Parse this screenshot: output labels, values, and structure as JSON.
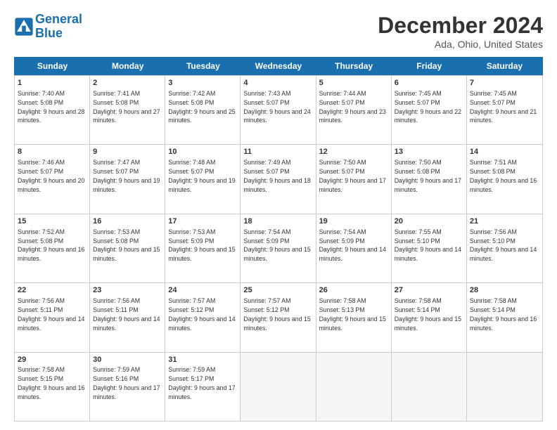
{
  "header": {
    "logo_line1": "General",
    "logo_line2": "Blue",
    "month": "December 2024",
    "location": "Ada, Ohio, United States"
  },
  "weekdays": [
    "Sunday",
    "Monday",
    "Tuesday",
    "Wednesday",
    "Thursday",
    "Friday",
    "Saturday"
  ],
  "weeks": [
    [
      {
        "day": "1",
        "sunrise": "Sunrise: 7:40 AM",
        "sunset": "Sunset: 5:08 PM",
        "daylight": "Daylight: 9 hours and 28 minutes."
      },
      {
        "day": "2",
        "sunrise": "Sunrise: 7:41 AM",
        "sunset": "Sunset: 5:08 PM",
        "daylight": "Daylight: 9 hours and 27 minutes."
      },
      {
        "day": "3",
        "sunrise": "Sunrise: 7:42 AM",
        "sunset": "Sunset: 5:08 PM",
        "daylight": "Daylight: 9 hours and 25 minutes."
      },
      {
        "day": "4",
        "sunrise": "Sunrise: 7:43 AM",
        "sunset": "Sunset: 5:07 PM",
        "daylight": "Daylight: 9 hours and 24 minutes."
      },
      {
        "day": "5",
        "sunrise": "Sunrise: 7:44 AM",
        "sunset": "Sunset: 5:07 PM",
        "daylight": "Daylight: 9 hours and 23 minutes."
      },
      {
        "day": "6",
        "sunrise": "Sunrise: 7:45 AM",
        "sunset": "Sunset: 5:07 PM",
        "daylight": "Daylight: 9 hours and 22 minutes."
      },
      {
        "day": "7",
        "sunrise": "Sunrise: 7:45 AM",
        "sunset": "Sunset: 5:07 PM",
        "daylight": "Daylight: 9 hours and 21 minutes."
      }
    ],
    [
      {
        "day": "8",
        "sunrise": "Sunrise: 7:46 AM",
        "sunset": "Sunset: 5:07 PM",
        "daylight": "Daylight: 9 hours and 20 minutes."
      },
      {
        "day": "9",
        "sunrise": "Sunrise: 7:47 AM",
        "sunset": "Sunset: 5:07 PM",
        "daylight": "Daylight: 9 hours and 19 minutes."
      },
      {
        "day": "10",
        "sunrise": "Sunrise: 7:48 AM",
        "sunset": "Sunset: 5:07 PM",
        "daylight": "Daylight: 9 hours and 19 minutes."
      },
      {
        "day": "11",
        "sunrise": "Sunrise: 7:49 AM",
        "sunset": "Sunset: 5:07 PM",
        "daylight": "Daylight: 9 hours and 18 minutes."
      },
      {
        "day": "12",
        "sunrise": "Sunrise: 7:50 AM",
        "sunset": "Sunset: 5:07 PM",
        "daylight": "Daylight: 9 hours and 17 minutes."
      },
      {
        "day": "13",
        "sunrise": "Sunrise: 7:50 AM",
        "sunset": "Sunset: 5:08 PM",
        "daylight": "Daylight: 9 hours and 17 minutes."
      },
      {
        "day": "14",
        "sunrise": "Sunrise: 7:51 AM",
        "sunset": "Sunset: 5:08 PM",
        "daylight": "Daylight: 9 hours and 16 minutes."
      }
    ],
    [
      {
        "day": "15",
        "sunrise": "Sunrise: 7:52 AM",
        "sunset": "Sunset: 5:08 PM",
        "daylight": "Daylight: 9 hours and 16 minutes."
      },
      {
        "day": "16",
        "sunrise": "Sunrise: 7:53 AM",
        "sunset": "Sunset: 5:08 PM",
        "daylight": "Daylight: 9 hours and 15 minutes."
      },
      {
        "day": "17",
        "sunrise": "Sunrise: 7:53 AM",
        "sunset": "Sunset: 5:09 PM",
        "daylight": "Daylight: 9 hours and 15 minutes."
      },
      {
        "day": "18",
        "sunrise": "Sunrise: 7:54 AM",
        "sunset": "Sunset: 5:09 PM",
        "daylight": "Daylight: 9 hours and 15 minutes."
      },
      {
        "day": "19",
        "sunrise": "Sunrise: 7:54 AM",
        "sunset": "Sunset: 5:09 PM",
        "daylight": "Daylight: 9 hours and 14 minutes."
      },
      {
        "day": "20",
        "sunrise": "Sunrise: 7:55 AM",
        "sunset": "Sunset: 5:10 PM",
        "daylight": "Daylight: 9 hours and 14 minutes."
      },
      {
        "day": "21",
        "sunrise": "Sunrise: 7:56 AM",
        "sunset": "Sunset: 5:10 PM",
        "daylight": "Daylight: 9 hours and 14 minutes."
      }
    ],
    [
      {
        "day": "22",
        "sunrise": "Sunrise: 7:56 AM",
        "sunset": "Sunset: 5:11 PM",
        "daylight": "Daylight: 9 hours and 14 minutes."
      },
      {
        "day": "23",
        "sunrise": "Sunrise: 7:56 AM",
        "sunset": "Sunset: 5:11 PM",
        "daylight": "Daylight: 9 hours and 14 minutes."
      },
      {
        "day": "24",
        "sunrise": "Sunrise: 7:57 AM",
        "sunset": "Sunset: 5:12 PM",
        "daylight": "Daylight: 9 hours and 14 minutes."
      },
      {
        "day": "25",
        "sunrise": "Sunrise: 7:57 AM",
        "sunset": "Sunset: 5:12 PM",
        "daylight": "Daylight: 9 hours and 15 minutes."
      },
      {
        "day": "26",
        "sunrise": "Sunrise: 7:58 AM",
        "sunset": "Sunset: 5:13 PM",
        "daylight": "Daylight: 9 hours and 15 minutes."
      },
      {
        "day": "27",
        "sunrise": "Sunrise: 7:58 AM",
        "sunset": "Sunset: 5:14 PM",
        "daylight": "Daylight: 9 hours and 15 minutes."
      },
      {
        "day": "28",
        "sunrise": "Sunrise: 7:58 AM",
        "sunset": "Sunset: 5:14 PM",
        "daylight": "Daylight: 9 hours and 16 minutes."
      }
    ],
    [
      {
        "day": "29",
        "sunrise": "Sunrise: 7:58 AM",
        "sunset": "Sunset: 5:15 PM",
        "daylight": "Daylight: 9 hours and 16 minutes."
      },
      {
        "day": "30",
        "sunrise": "Sunrise: 7:59 AM",
        "sunset": "Sunset: 5:16 PM",
        "daylight": "Daylight: 9 hours and 17 minutes."
      },
      {
        "day": "31",
        "sunrise": "Sunrise: 7:59 AM",
        "sunset": "Sunset: 5:17 PM",
        "daylight": "Daylight: 9 hours and 17 minutes."
      },
      null,
      null,
      null,
      null
    ]
  ]
}
